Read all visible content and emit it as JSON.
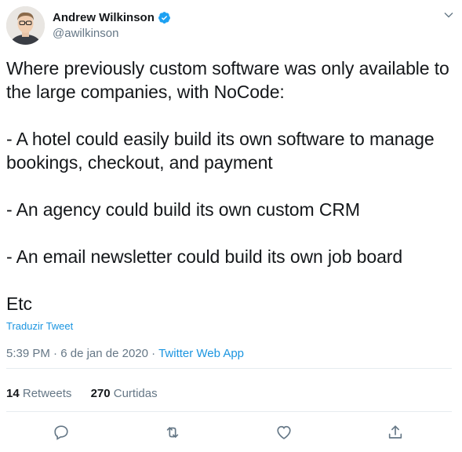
{
  "author": {
    "display_name": "Andrew Wilkinson",
    "handle": "@awilkinson",
    "verified": true,
    "avatar": "avatar-photo"
  },
  "tweet": {
    "text": "Where previously custom software was only available to the large companies, with NoCode:\n\n- A hotel could easily build its own software to manage bookings, checkout, and payment\n\n- An agency could build its own custom CRM\n\n- An email newsletter could build its own job board\n\nEtc",
    "translate_label": "Traduzir Tweet"
  },
  "meta": {
    "time": "5:39 PM",
    "separator1": " · ",
    "date": "6 de jan de 2020",
    "separator2": " · ",
    "source": "Twitter Web App"
  },
  "stats": {
    "retweets_count": "14",
    "retweets_label": " Retweets",
    "likes_count": "270",
    "likes_label": " Curtidas"
  },
  "icons": {
    "caret": "chevron-down-icon",
    "verified": "verified-badge-icon",
    "reply": "reply-icon",
    "retweet": "retweet-icon",
    "like": "heart-icon",
    "share": "share-icon"
  },
  "colors": {
    "text": "#14171a",
    "secondary": "#657786",
    "link": "#1b95e0",
    "divider": "#e6ecf0",
    "verified": "#1da1f2"
  }
}
